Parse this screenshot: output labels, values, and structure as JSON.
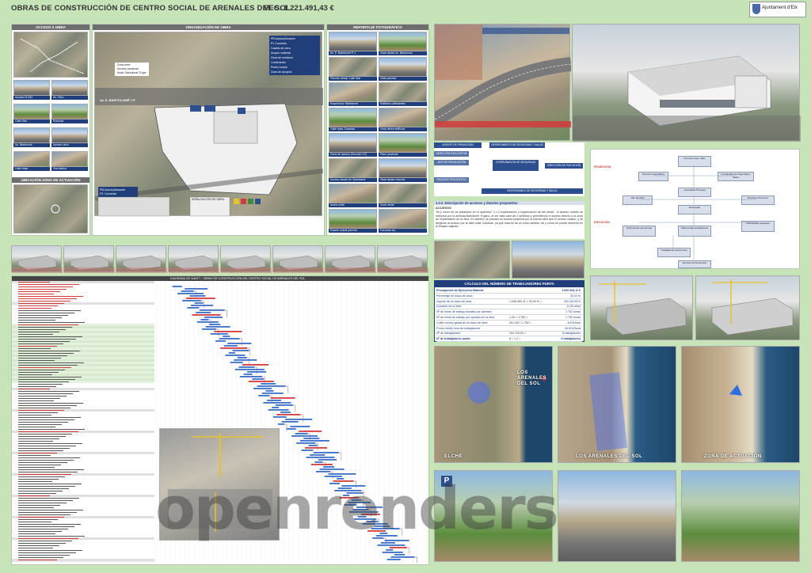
{
  "header": {
    "title": "OBRAS DE CONSTRUCCIÓN DE CENTRO SOCIAL DE ARENALES DEL SOL",
    "pec": "VEC: 1.221.491,43 €",
    "logo_text": "Ajuntament d'Elx"
  },
  "panels": {
    "acceso": "ACCESO A OBRA",
    "ubicacion": "UBICACIÓN ZONA DE ACTUACIÓN",
    "organizacion": "ORGANIZACIÓN DE OBRA",
    "reportaje": "REPORTAJE FOTOGRÁFICO"
  },
  "org_labels": [
    "PB Aseos/Almacén",
    "P1 Comedor",
    "Caseta de obra",
    "Acopio material",
    "Zona de residuos",
    "Contenedor",
    "Punto Limpio",
    "Zona de acopios",
    "Grúa torre",
    "Acceso peatonal",
    "Avda. Bartolomé Troya"
  ],
  "org_bottom_labels": [
    "PB Aseos/Almacén",
    "P1 Comedor"
  ],
  "street_label": "Av. E. BARTOLOMÉ 7-P",
  "legend_title": "SEÑALIZACIÓN DE OBRA",
  "acceso_captions": [
    "Acceso N-332",
    "Av. Tinto",
    "Calle Mar",
    "Rotonda",
    "Av. Bartolomé",
    "Acceso obra",
    "Calle Islas",
    "Vial interior"
  ],
  "reportaje_captions": [
    "Av. E. Bartolomé P-1",
    "Vista desde Av. Bartolomé",
    "Parcela desde Calle Mar",
    "Vista parcela",
    "Esquina Av. Bartolomé",
    "Edificios colindantes",
    "Calle Islas Canarias",
    "Vista aérea edificios",
    "Zona de acceso (Sección C2)",
    "Paso peatonal",
    "Acceso desde Av. Bartolomé",
    "Vista desde rotonda",
    "Acera norte",
    "Zona verde",
    "Estado actual parcela",
    "Fachada sur"
  ],
  "org_chart": {
    "labels": [
      "Promotor Ayto. d'Elx",
      "Dirección Facultativa",
      "Coordinador de Seguridad y Salud",
      "Contratista Principal",
      "Jefe de Obra",
      "Encargado",
      "Recurso Preventivo",
      "Subcontrata estructuras",
      "Subcontrata instalaciones",
      "Subcontrata acabados",
      "Trabajadores autónomos",
      "Servicio de Prevención"
    ],
    "side_left": "PROMOCIÓN",
    "side_left2": "EJECUCIÓN"
  },
  "blocks": {
    "row1": [
      "AGENTE DE PROMOCIÓN",
      "DEPARTAMENTO DE SEGURIDAD Y SALUD"
    ],
    "row2": [
      "DIRECCIÓN FACULTATIVA",
      "COORDINACIÓN DE SEGURIDAD",
      "DIRECCIÓN DE EJECUCIÓN"
    ],
    "row3": [
      "JEFE DE PRODUCCIÓN",
      "RECURSO PREVENTIVO",
      "RESPONSABLE DE SEGURIDAD Y SALUD"
    ]
  },
  "access_text": {
    "heading": "1.2.2. Descripción de accesos y desvíos propuestos",
    "subheading": "ACCESOS",
    "body": "Tal y como se ha planteado en el apartado \"1.1.2 Implantación y organización de las obras\", el acceso rodado se realizará por la avenida Bartolomé Trujano, al ser esta calle de 2 sentidos y permitiendo el acceso directo a la zona de implantación de la obra. En cambio, se plantea un acceso peatonal por la misma calle que el acceso rodado, y se tangente al acceso por la calle Islas Canarias, ya que esta es de un único sentido, tal y como se puede observar en la imagen adjunta."
  },
  "calc_table": {
    "title": "CÁLCULO DEL NÚMERO DE TRABAJADORES PUNTA",
    "rows": [
      [
        "Presupuesto de Ejecución Material",
        "",
        "1.006.463,11 €"
      ],
      [
        "Porcentaje de mano de obra",
        "",
        "20,00 %"
      ],
      [
        "Importe de la mano de obra",
        "1.006.463,11 × 20,00 % =",
        "201.292,62 €"
      ],
      [
        "Duración de la obra",
        "",
        "11,50 años"
      ],
      [
        "Nº de horas de trabajo anuales por operario",
        "",
        "1.752 horas"
      ],
      [
        "Nº de horas de trabajo por operario en la obra",
        "1,00 × 1.752 =",
        "1.752 horas"
      ],
      [
        "Coste horario global de la mano de obra",
        "201.292 / 1.752 =",
        "115 €/hora"
      ],
      [
        "Precio medio hora de trabajadores",
        "",
        "16,00 €/hora"
      ],
      [
        "Nº de trabajadores",
        "115 / 16,00 =",
        "8 trabajadores"
      ],
      [
        "Nº de trabajadores punta",
        "8 × 1,2 =",
        "9 trabajadores"
      ]
    ]
  },
  "gantt": {
    "title": "DIAGRAMA DE GANTT - OBRAS DE CONSTRUCCIÓN DEL CENTRO SOCIAL DE ARENALES DEL SOL"
  },
  "location_labels": {
    "map1": "ELCHE",
    "map1_city": "LOS ARENALES DEL SOL",
    "map2": "LOS ARENALES DEL SOL",
    "map3": "ZONA DE ACTUACIÓN"
  },
  "watermark": "openrenders",
  "colors": {
    "background": "#c7e3b8",
    "panel_title": "#6e6e6e",
    "caption": "#1f3e7a",
    "accent_blue": "#2d4f8f",
    "gantt_red": "#d23b3b"
  }
}
